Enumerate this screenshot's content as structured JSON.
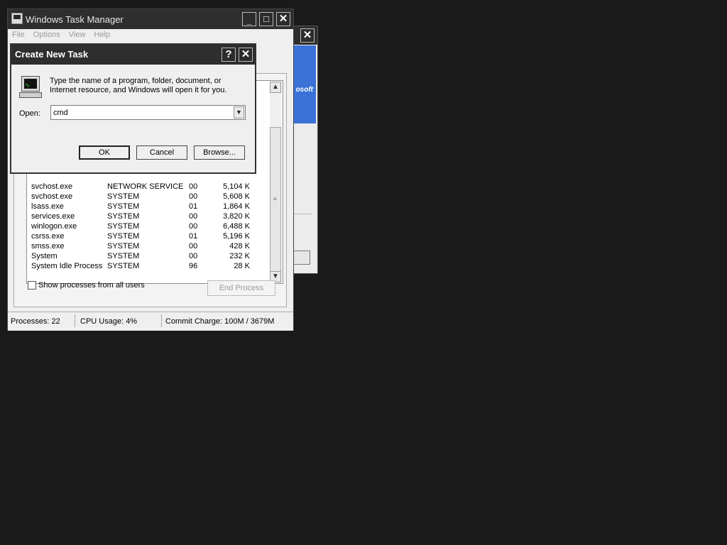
{
  "bg_window": {
    "close_glyph": "✕",
    "banner_text": "osoft"
  },
  "task_manager": {
    "title": "Windows Task Manager",
    "controls": {
      "minimize": "_",
      "maximize": "□",
      "close": "✕"
    },
    "menu": [
      "File",
      "Options",
      "View",
      "Help"
    ],
    "processes": [
      {
        "name": "svchost.exe",
        "user": "NETWORK SERVICE",
        "cpu": "00",
        "mem": "5,104 K"
      },
      {
        "name": "svchost.exe",
        "user": "SYSTEM",
        "cpu": "00",
        "mem": "5,608 K"
      },
      {
        "name": "lsass.exe",
        "user": "SYSTEM",
        "cpu": "01",
        "mem": "1,864 K"
      },
      {
        "name": "services.exe",
        "user": "SYSTEM",
        "cpu": "00",
        "mem": "3,820 K"
      },
      {
        "name": "winlogon.exe",
        "user": "SYSTEM",
        "cpu": "00",
        "mem": "6,488 K"
      },
      {
        "name": "csrss.exe",
        "user": "SYSTEM",
        "cpu": "01",
        "mem": "5,196 K"
      },
      {
        "name": "smss.exe",
        "user": "SYSTEM",
        "cpu": "00",
        "mem": "428 K"
      },
      {
        "name": "System",
        "user": "SYSTEM",
        "cpu": "00",
        "mem": "232 K"
      },
      {
        "name": "System Idle Process",
        "user": "SYSTEM",
        "cpu": "96",
        "mem": "28 K"
      }
    ],
    "show_all_users_label": "Show processes from all users",
    "show_all_users_checked": false,
    "end_process_label": "End Process",
    "status": {
      "processes": "Processes: 22",
      "cpu": "CPU Usage: 4%",
      "commit": "Commit Charge: 100M / 3679M"
    }
  },
  "dialog": {
    "title": "Create New Task",
    "help_glyph": "?",
    "close_glyph": "✕",
    "description": "Type the name of a program, folder, document, or Internet resource, and Windows will open it for you.",
    "open_label": "Open:",
    "open_value": "cmd",
    "ok_label": "OK",
    "cancel_label": "Cancel",
    "browse_label": "Browse..."
  }
}
